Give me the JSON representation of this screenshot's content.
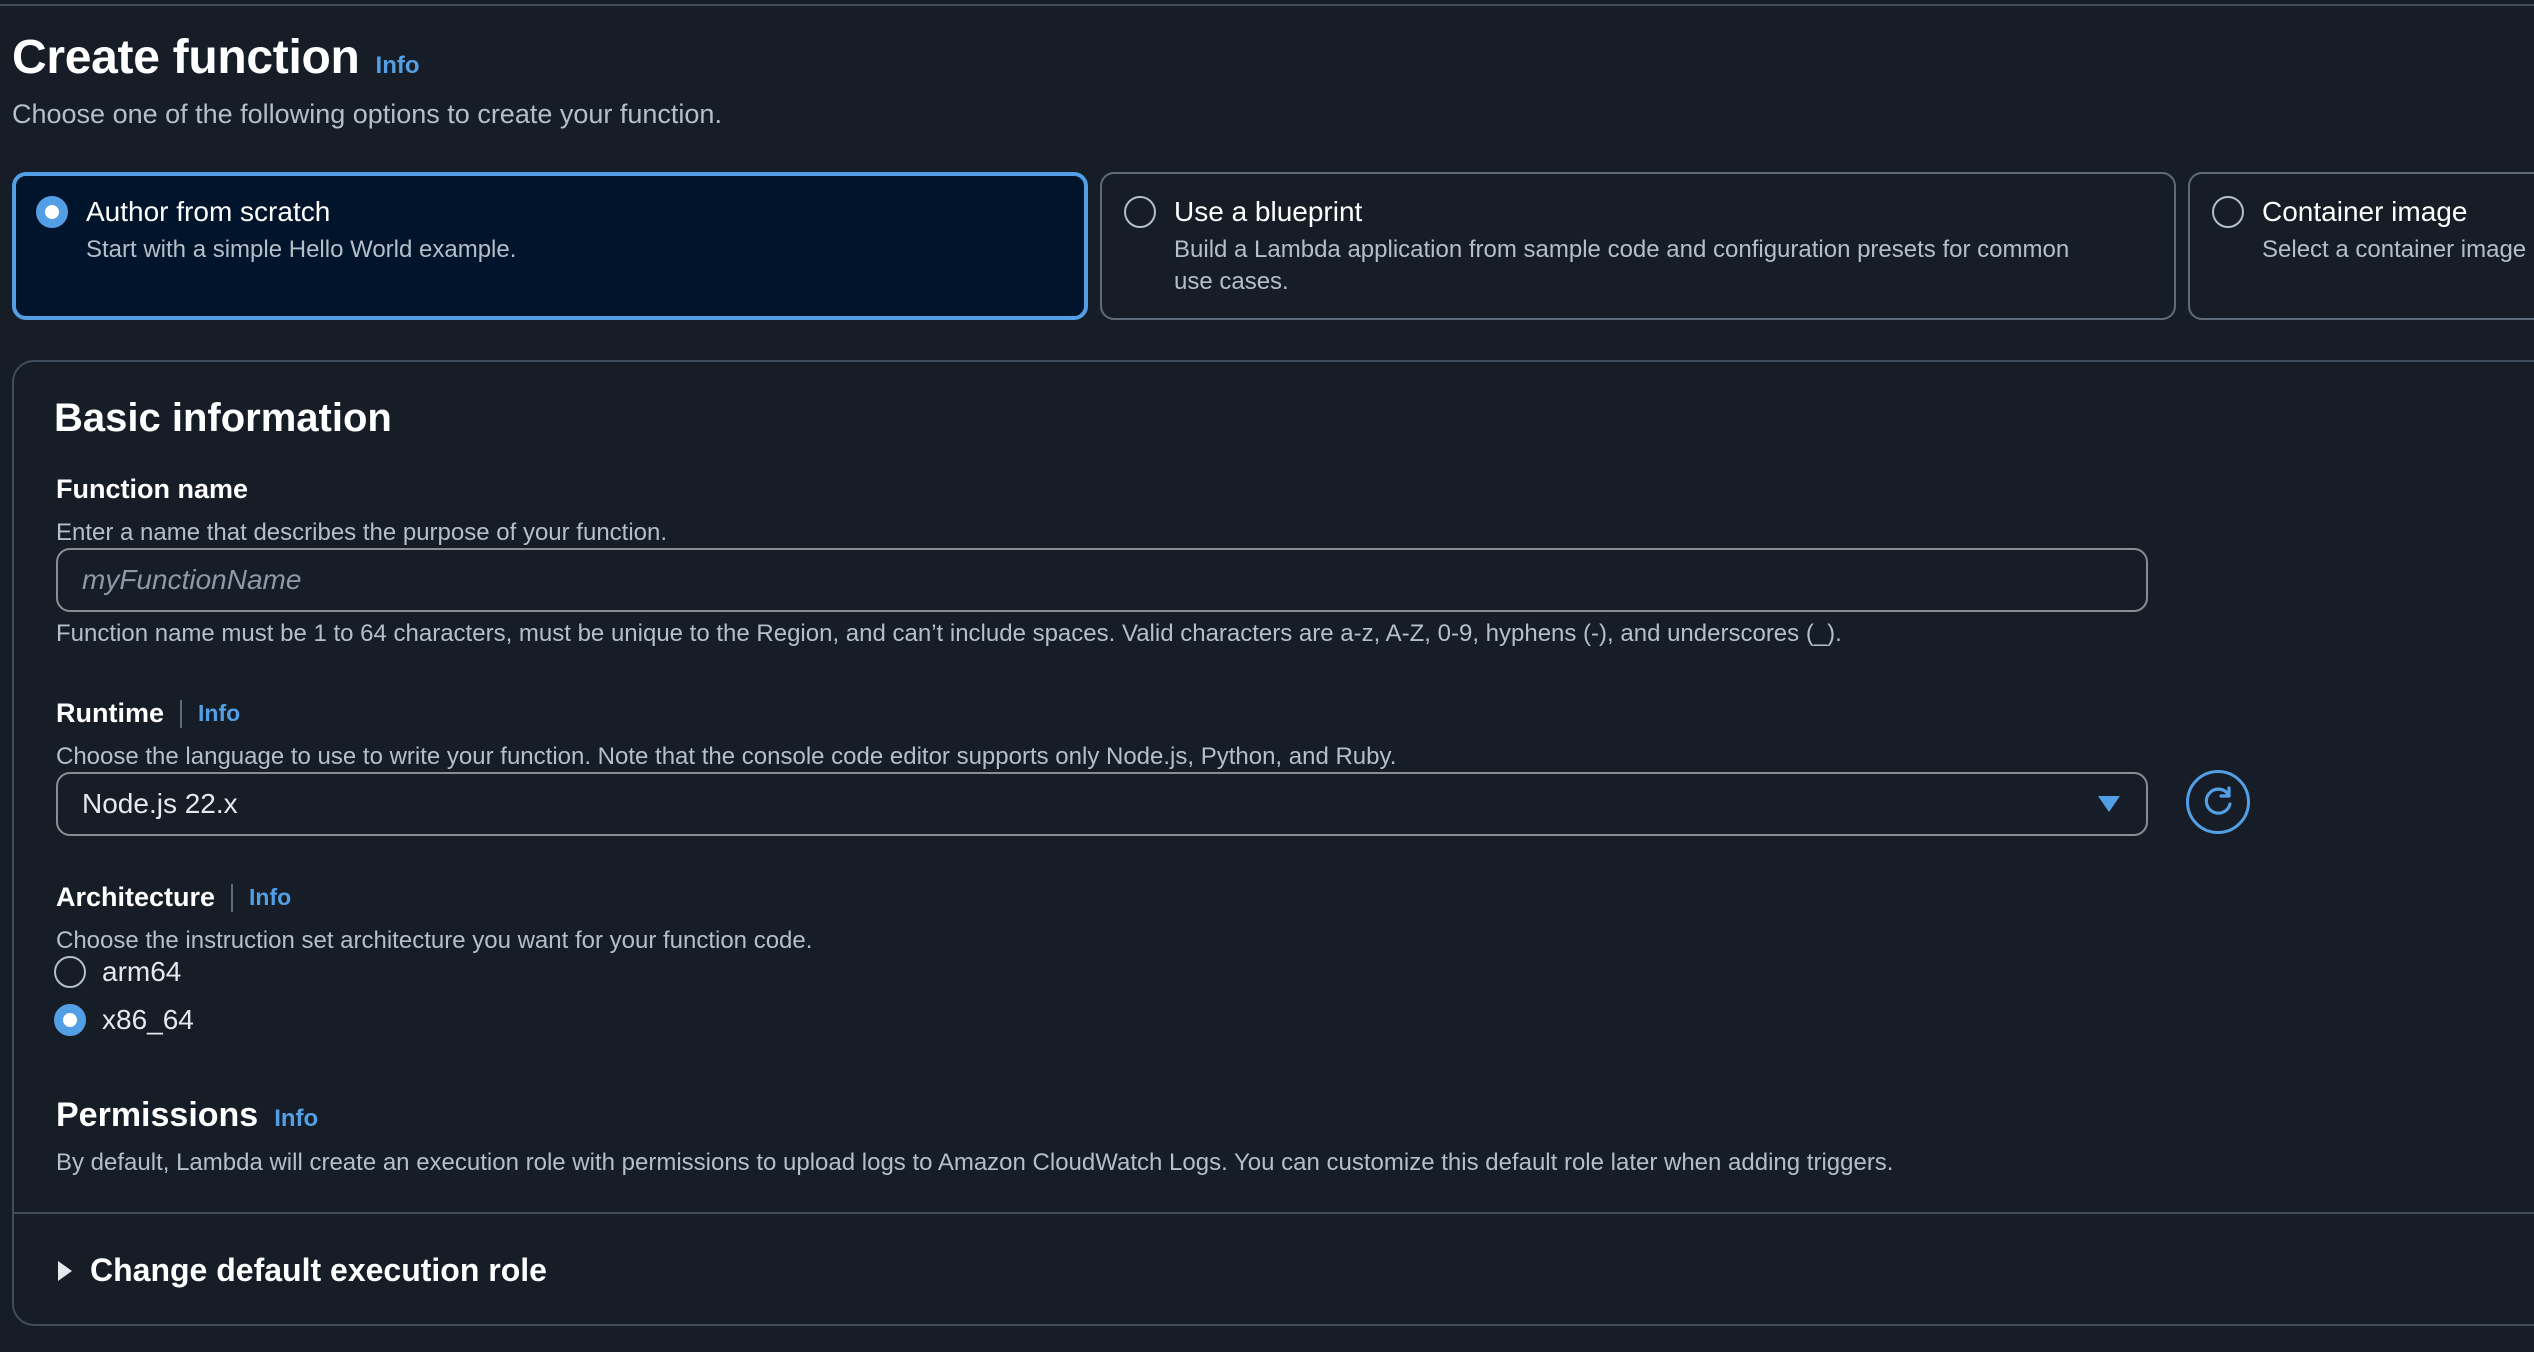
{
  "header": {
    "title": "Create function",
    "info_label": "Info",
    "description": "Choose one of the following options to create your function."
  },
  "options": [
    {
      "title": "Author from scratch",
      "description": "Start with a simple Hello World example.",
      "selected": true
    },
    {
      "title": "Use a blueprint",
      "description": "Build a Lambda application from sample code and configuration presets for common use cases.",
      "selected": false
    },
    {
      "title": "Container image",
      "description": "Select a container image",
      "selected": false
    }
  ],
  "basic_info": {
    "title": "Basic information",
    "function_name": {
      "label": "Function name",
      "description": "Enter a name that describes the purpose of your function.",
      "placeholder": "myFunctionName",
      "value": "",
      "constraint": "Function name must be 1 to 64 characters, must be unique to the Region, and can’t include spaces. Valid characters are a-z, A-Z, 0-9, hyphens (-), and underscores (_)."
    },
    "runtime": {
      "label": "Runtime",
      "info_label": "Info",
      "description": "Choose the language to use to write your function. Note that the console code editor supports only Node.js, Python, and Ruby.",
      "selected_value": "Node.js 22.x"
    },
    "architecture": {
      "label": "Architecture",
      "info_label": "Info",
      "description": "Choose the instruction set architecture you want for your function code.",
      "options": [
        {
          "label": "arm64",
          "selected": false
        },
        {
          "label": "x86_64",
          "selected": true
        }
      ]
    },
    "permissions": {
      "title": "Permissions",
      "info_label": "Info",
      "description": "By default, Lambda will create an execution role with permissions to upload logs to Amazon CloudWatch Logs. You can customize this default role later when adding triggers."
    },
    "expander_label": "Change default execution role"
  },
  "colors": {
    "accent": "#539fe5",
    "background": "#161d26",
    "selected_tile_bg": "#00142b",
    "border": "#414d5c"
  },
  "icons": [
    "radio-button",
    "dropdown-caret-icon",
    "refresh-icon",
    "expand-triangle-icon"
  ]
}
